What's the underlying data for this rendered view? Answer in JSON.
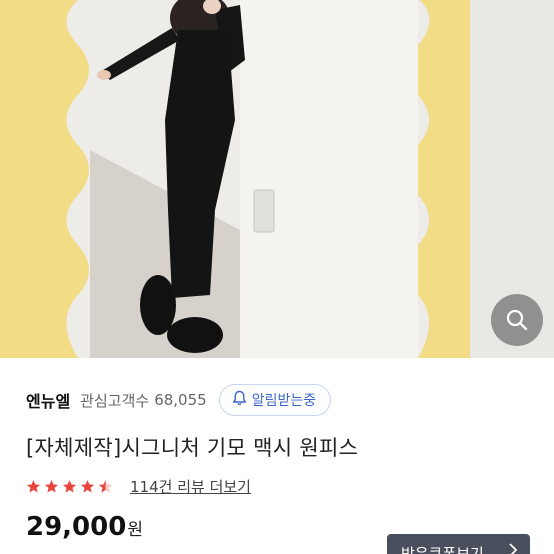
{
  "product_image": {
    "alt_icon": "photo",
    "zoom_icon": "search-icon"
  },
  "shop": {
    "name": "엔뉴엘",
    "follower_label": "관심고객수",
    "follower_count": "68,055",
    "alarm_button": "알림받는중",
    "alarm_icon": "bell-icon"
  },
  "product": {
    "title": "[자체제작]시그니처 기모 맥시 원피스",
    "rating": 4.5,
    "rating_max": 5,
    "review_link": "114건 리뷰 더보기",
    "price": "29,000",
    "price_unit": "원",
    "coupon_button": "받은쿠폰보기"
  },
  "colors": {
    "star": "#e8453c",
    "accent_blue": "#3d66c9",
    "coupon_bg": "#4a4f5d"
  }
}
